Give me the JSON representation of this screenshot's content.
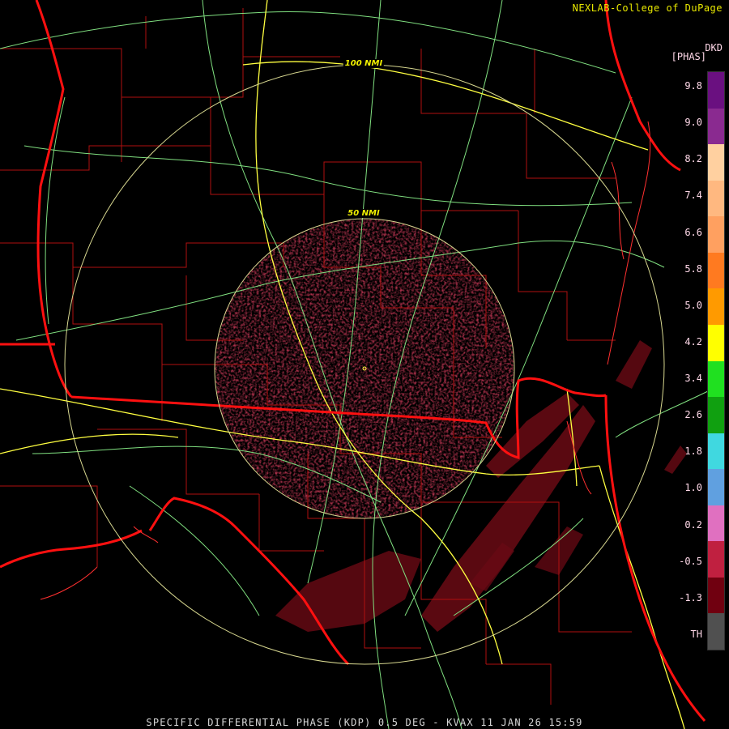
{
  "credit": "NEXLAB-College of DuPage",
  "product_code": "DKD",
  "units": "[PHAS]",
  "caption": "SPECIFIC DIFFERENTIAL PHASE (KDP) 0.5 DEG - KVAX 11 JAN 26 15:59",
  "range_rings": [
    {
      "label": "100 NMI"
    },
    {
      "label": "50 NMI"
    }
  ],
  "color_scale": {
    "labels": [
      "9.8",
      "9.0",
      "8.2",
      "7.4",
      "6.6",
      "5.8",
      "5.0",
      "4.2",
      "3.4",
      "2.6",
      "1.8",
      "1.0",
      "0.2",
      "-0.5",
      "-1.3",
      "TH"
    ],
    "colors": [
      "#6a1080",
      "#8a2a90",
      "#ffd0a0",
      "#ffb880",
      "#ffa060",
      "#ff7a20",
      "#ff9a00",
      "#ffff00",
      "#20e020",
      "#10a010",
      "#40d8e0",
      "#60a0e0",
      "#e070c0",
      "#c02040",
      "#700010",
      "#505050"
    ]
  },
  "colors": {
    "background": "#000000",
    "state_border": "#ff1010",
    "county_line": "#b01010",
    "highway": "#ffff40",
    "road": "#80e080",
    "range_ring": "#d8d890",
    "echo": "#6a0a14"
  }
}
